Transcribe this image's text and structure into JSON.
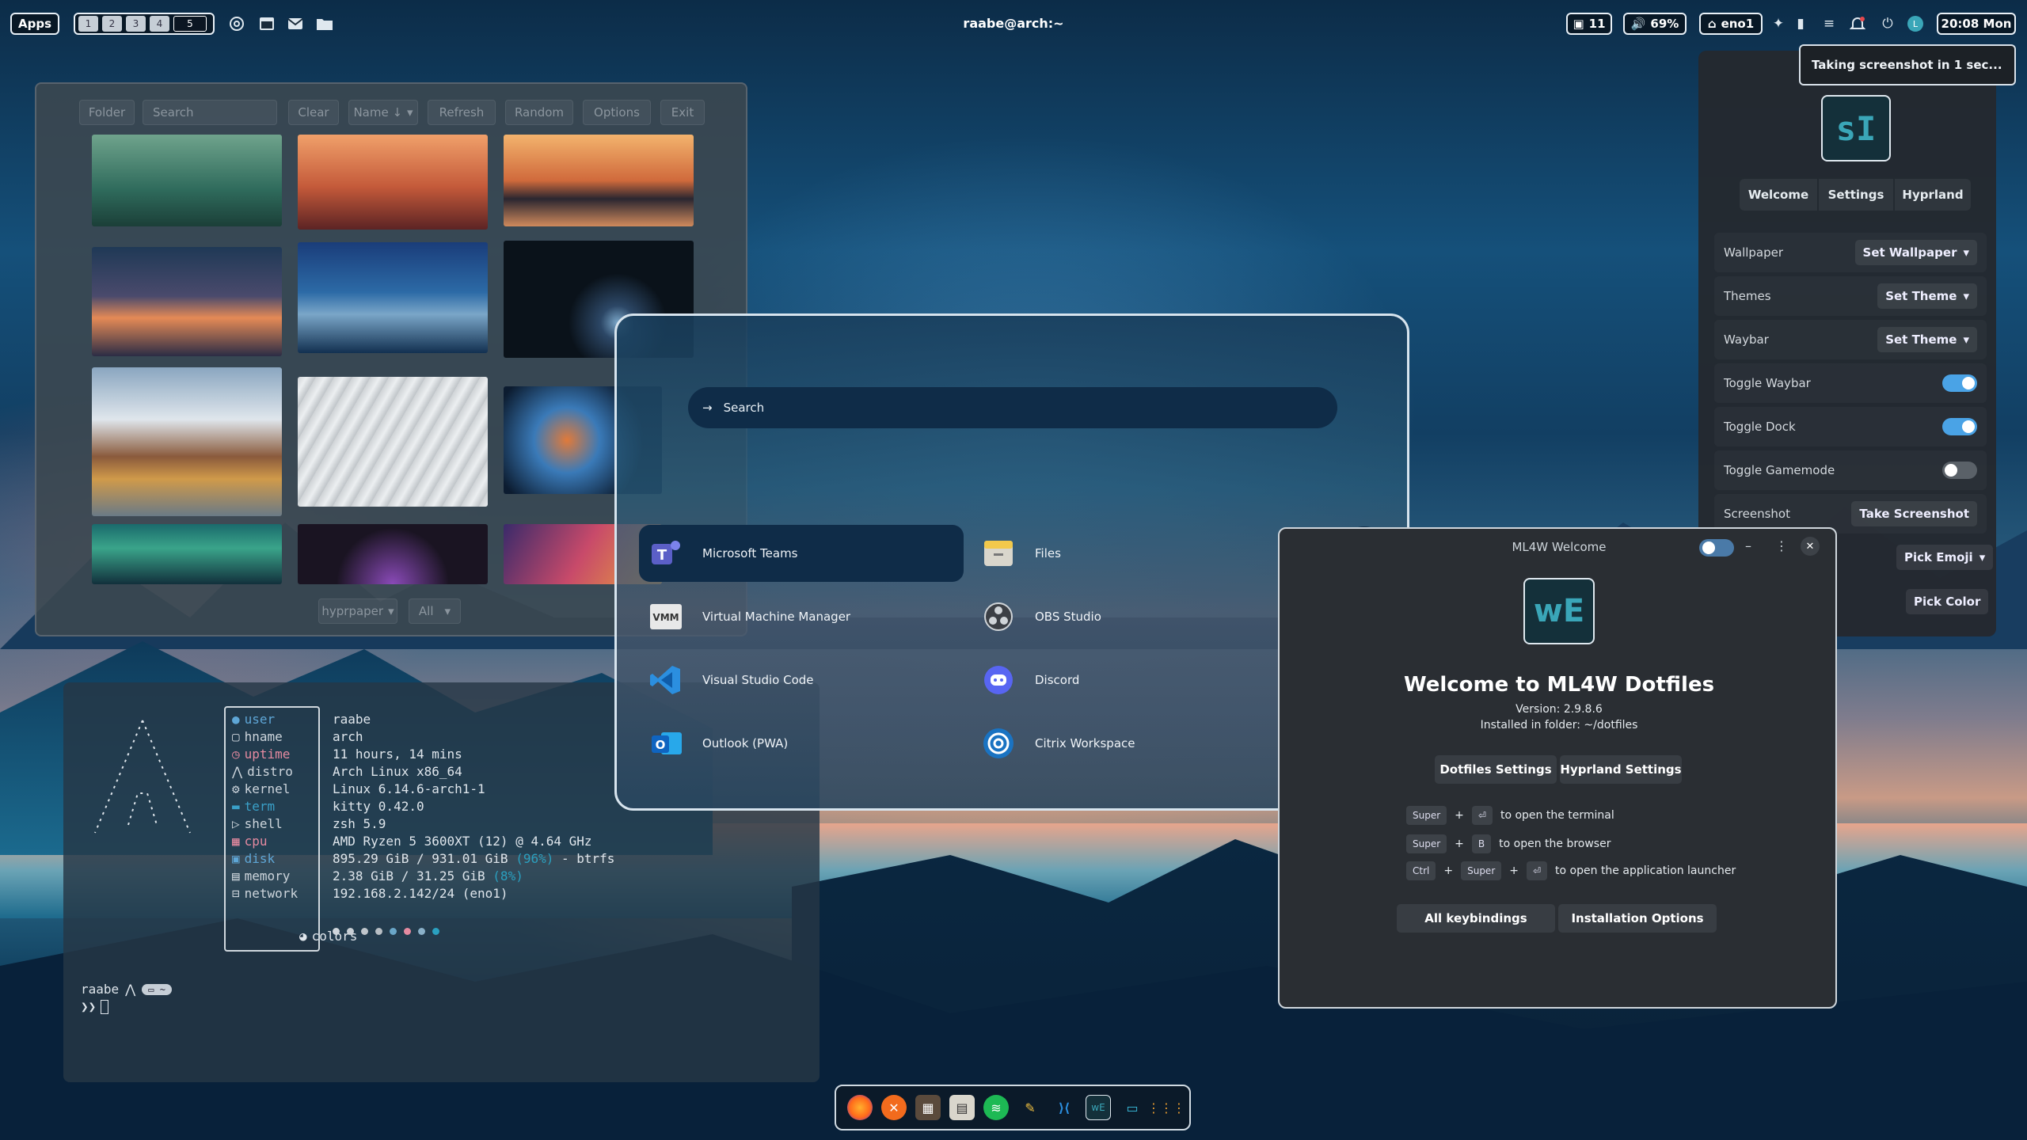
{
  "topbar": {
    "apps_label": "Apps",
    "workspaces": [
      "1",
      "2",
      "3",
      "4",
      "5"
    ],
    "title": "raabe@arch:~",
    "updates": "11",
    "volume": "69%",
    "network": "eno1",
    "clock": "20:08 Mon"
  },
  "notification": {
    "text": "Taking screenshot in 1 sec..."
  },
  "wallpaper_selector": {
    "toolbar": {
      "folder": "Folder",
      "search_placeholder": "Search",
      "clear": "Clear",
      "sort": "Name ↓",
      "refresh": "Refresh",
      "random": "Random",
      "options": "Options",
      "exit": "Exit"
    },
    "footer": {
      "backend": "hyprpaper",
      "filter": "All"
    }
  },
  "terminal": {
    "fetch": [
      {
        "key": "user",
        "value": "raabe",
        "color": "#5ea6d6"
      },
      {
        "key": "hname",
        "value": "arch",
        "color": "#cdd5dc"
      },
      {
        "key": "uptime",
        "value": "11 hours, 14 mins",
        "color": "#e58aa0"
      },
      {
        "key": "distro",
        "value": "Arch Linux x86_64",
        "color": "#cdd5dc"
      },
      {
        "key": "kernel",
        "value": "Linux 6.14.6-arch1-1",
        "color": "#cdd5dc"
      },
      {
        "key": "term",
        "value": "kitty 0.42.0",
        "color": "#3aa0c8"
      },
      {
        "key": "shell",
        "value": "zsh 5.9",
        "color": "#cdd5dc"
      },
      {
        "key": "cpu",
        "value": "AMD Ryzen 5 3600XT (12) @ 4.64 GHz",
        "color": "#e58aa0"
      },
      {
        "key": "disk",
        "value": "895.29 GiB / 931.01 GiB",
        "color": "#5ea6d6"
      },
      {
        "key": "memory",
        "value": "2.38 GiB / 31.25 GiB",
        "color": "#cdd5dc"
      },
      {
        "key": "network",
        "value": "192.168.2.142/24 (eno1)",
        "color": "#cdd5dc"
      }
    ],
    "disk_pct": "(96%)",
    "disk_fs": " - btrfs",
    "mem_pct": "(8%)",
    "colors_label": "colors",
    "prompt_user": "raabe",
    "prompt_dir": "~",
    "prompt_symbol": "❯❯"
  },
  "launcher": {
    "search_placeholder": "Search",
    "apps": [
      {
        "label": "Microsoft Teams",
        "icon": "teams-icon",
        "color": "#5b5fc7"
      },
      {
        "label": "Files",
        "icon": "files-icon",
        "color": "#d9d6cc"
      },
      {
        "label": "Virtual Machine Manager",
        "icon": "virt-manager-icon",
        "color": "#e8e8e8"
      },
      {
        "label": "OBS Studio",
        "icon": "obs-icon",
        "color": "#3b3f45"
      },
      {
        "label": "Visual Studio Code",
        "icon": "vscode-icon",
        "color": "#2b8fe0"
      },
      {
        "label": "Discord",
        "icon": "discord-icon",
        "color": "#5865f2"
      },
      {
        "label": "Outlook (PWA)",
        "icon": "outlook-icon",
        "color": "#1f70c8"
      },
      {
        "label": "Citrix Workspace",
        "icon": "citrix-icon",
        "color": "#1a73c2"
      }
    ]
  },
  "settings": {
    "logo_text": "sI",
    "tabs": [
      "Welcome",
      "Settings",
      "Hyprland"
    ],
    "rows": [
      {
        "label": "Wallpaper",
        "button": "Set Wallpaper"
      },
      {
        "label": "Themes",
        "button": "Set Theme"
      },
      {
        "label": "Waybar",
        "button": "Set Theme"
      },
      {
        "label": "Toggle Waybar",
        "toggle": "on"
      },
      {
        "label": "Toggle Dock",
        "toggle": "on"
      },
      {
        "label": "Toggle Gamemode",
        "toggle": "off"
      },
      {
        "label": "Screenshot",
        "button": "Take Screenshot"
      }
    ],
    "emoji_button": "Pick Emoji",
    "color_button": "Pick Color"
  },
  "welcome": {
    "window_title": "ML4W Welcome",
    "logo_text": "wE",
    "heading": "Welcome to ML4W Dotfiles",
    "version": "Version: 2.9.8.6",
    "installed": "Installed in folder: ~/dotfiles",
    "btn_dotfiles": "Dotfiles Settings",
    "btn_hyprland": "Hyprland Settings",
    "shortcuts": [
      {
        "keys": [
          "Super",
          "⏎"
        ],
        "desc": "to open the terminal"
      },
      {
        "keys": [
          "Super",
          "B"
        ],
        "desc": "to open the browser"
      },
      {
        "keys": [
          "Ctrl",
          "Super",
          "⏎"
        ],
        "desc": "to open the application launcher"
      }
    ],
    "btn_keybindings": "All keybindings",
    "btn_install": "Installation Options"
  },
  "dock": {
    "icons": [
      "firefox-icon",
      "close-app-icon",
      "mixer-icon",
      "files-icon",
      "spotify-icon",
      "feather-icon",
      "vscode-icon",
      "welcome-icon",
      "monitor-icon",
      "app-grid-icon"
    ]
  }
}
